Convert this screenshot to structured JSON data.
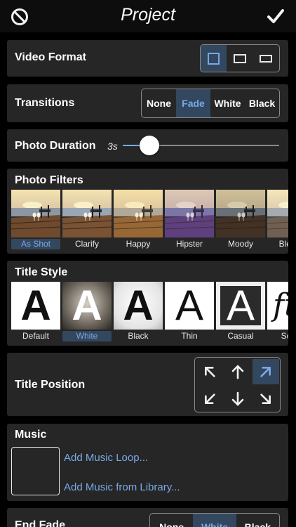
{
  "header": {
    "title": "Project",
    "cancel_icon": "cancel-icon",
    "done_icon": "checkmark-icon"
  },
  "video_format": {
    "label": "Video Format",
    "options": [
      "square-format-icon",
      "widescreen-format-icon",
      "cinema-format-icon"
    ],
    "selected": 0
  },
  "transitions": {
    "label": "Transitions",
    "options": [
      "None",
      "Fade",
      "White",
      "Black"
    ],
    "selected": "Fade"
  },
  "photo_duration": {
    "label": "Photo Duration",
    "value": "3s",
    "fraction": 0.17
  },
  "photo_filters": {
    "label": "Photo Filters",
    "items": [
      "As Shot",
      "Clarify",
      "Happy",
      "Hipster",
      "Moody",
      "Bleach"
    ],
    "selected": "As Shot"
  },
  "title_style": {
    "label": "Title Style",
    "items": [
      "Default",
      "White",
      "Black",
      "Thin",
      "Casual",
      "Script"
    ],
    "selected": "White",
    "sample_letters": [
      "A",
      "A",
      "A",
      "A",
      "A",
      "ft"
    ]
  },
  "title_position": {
    "label": "Title Position",
    "icons": [
      "arrow-up-left-icon",
      "arrow-up-icon",
      "arrow-up-right-icon",
      "arrow-down-left-icon",
      "arrow-down-icon",
      "arrow-down-right-icon"
    ],
    "selected": "arrow-up-right-icon"
  },
  "music": {
    "label": "Music",
    "add_loop": "Add Music Loop...",
    "add_library": "Add Music from Library..."
  },
  "end_fade": {
    "label": "End Fade",
    "options": [
      "None",
      "White",
      "Black"
    ],
    "selected": "White"
  },
  "colors": {
    "accent": "#79a9e6",
    "selected_bg": "#33475f",
    "panel": "#262626"
  }
}
